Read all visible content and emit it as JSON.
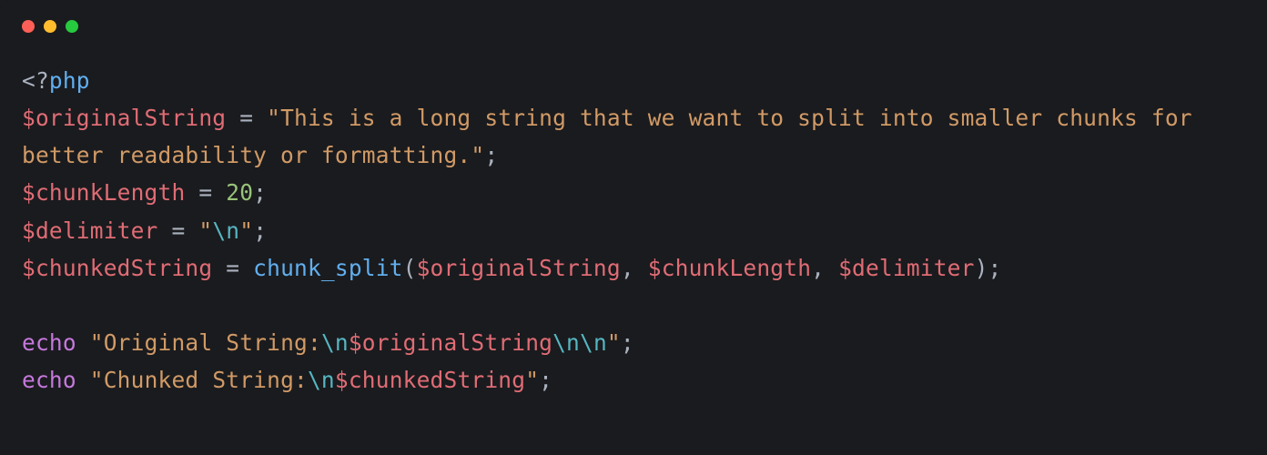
{
  "titlebar": {
    "close_color": "#ff5f56",
    "minimize_color": "#ffbd2e",
    "maximize_color": "#27c93f"
  },
  "code": {
    "line1": {
      "open": "<?",
      "php": "php"
    },
    "line2": {
      "var": "$originalString",
      "eq": " = ",
      "str1": "\"This is a long string that we want to split into smaller chunks for better readability or formatting.\"",
      "semi": ";"
    },
    "line3": {
      "var": "$chunkLength",
      "eq": " = ",
      "num": "20",
      "semi": ";"
    },
    "line4": {
      "var": "$delimiter",
      "eq": " = ",
      "q1": "\"",
      "esc": "\\n",
      "q2": "\"",
      "semi": ";"
    },
    "line5": {
      "var": "$chunkedString",
      "eq": " = ",
      "func": "chunk_split",
      "open": "(",
      "arg1": "$originalString",
      "c1": ", ",
      "arg2": "$chunkLength",
      "c2": ", ",
      "arg3": "$delimiter",
      "close": ")",
      "semi": ";"
    },
    "line7": {
      "echo": "echo",
      "sp": " ",
      "q1": "\"",
      "s1": "Original String:",
      "esc1": "\\n",
      "interp": "$originalString",
      "esc2": "\\n\\n",
      "q2": "\"",
      "semi": ";"
    },
    "line8": {
      "echo": "echo",
      "sp": " ",
      "q1": "\"",
      "s1": "Chunked String:",
      "esc1": "\\n",
      "interp": "$chunkedString",
      "q2": "\"",
      "semi": ";"
    }
  }
}
